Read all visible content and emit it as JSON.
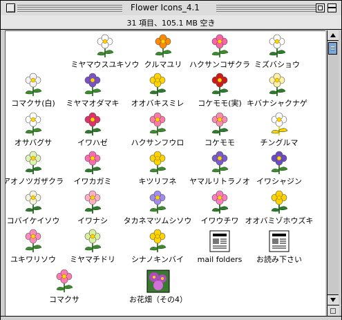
{
  "window": {
    "title": "Flower Icons_4.1",
    "info": "31 項目、105.1 MB 空き"
  },
  "items": [
    {
      "label": "ミヤマウスユキソウ",
      "icon": "white-edelweiss-flower-icon",
      "colors": [
        "#ffffff",
        "#3f8a2f"
      ]
    },
    {
      "label": "クルマユリ",
      "icon": "orange-lily-flower-icon",
      "colors": [
        "#ff8a00",
        "#3f8a2f"
      ]
    },
    {
      "label": "ハクサンコザクラ",
      "icon": "pink-primrose-flower-icon",
      "colors": [
        "#ff5ea8",
        "#3f8a2f"
      ]
    },
    {
      "label": "ミズバショウ",
      "icon": "white-skunk-cabbage-icon",
      "colors": [
        "#ffffff",
        "#2f7a2f"
      ]
    },
    {
      "label": "コマクサ(白)",
      "icon": "white-dicentra-flower-icon",
      "colors": [
        "#f4f4f4",
        "#3f8a2f"
      ]
    },
    {
      "label": "ミヤマオダマキ",
      "icon": "purple-columbine-flower-icon",
      "colors": [
        "#7a4fc8",
        "#3f8a2f"
      ]
    },
    {
      "label": "オオバキスミレ",
      "icon": "yellow-violet-flower-icon",
      "colors": [
        "#ffd400",
        "#2f7a2f"
      ]
    },
    {
      "label": "コケモモ(実)",
      "icon": "red-berries-icon",
      "colors": [
        "#d01818",
        "#2f7a2f"
      ]
    },
    {
      "label": "キバナシャクナゲ",
      "icon": "cream-rhododendron-flower-icon",
      "colors": [
        "#fff2a8",
        "#2f7a2f"
      ]
    },
    {
      "label": "オサバグサ",
      "icon": "white-fern-flower-icon",
      "colors": [
        "#ffffff",
        "#3f8a2f"
      ]
    },
    {
      "label": "イワハゼ",
      "icon": "red-white-bell-flower-icon",
      "colors": [
        "#e0306a",
        "#2f7a2f"
      ]
    },
    {
      "label": "ハクサンフウロ",
      "icon": "pink-geranium-flower-icon",
      "colors": [
        "#ff7aa8",
        "#3f8a2f"
      ]
    },
    {
      "label": "コケモモ",
      "icon": "pink-bell-flower-icon",
      "colors": [
        "#ff8ab0",
        "#2f7a2f"
      ]
    },
    {
      "label": "チングルマ",
      "icon": "white-avens-flower-icon",
      "colors": [
        "#ffffff",
        "#ffd400"
      ]
    },
    {
      "label": "アオノツガザクラ",
      "icon": "pale-green-bell-flower-icon",
      "colors": [
        "#dff2b8",
        "#2f7a2f"
      ]
    },
    {
      "label": "イワカガミ",
      "icon": "pink-fringed-flower-icon",
      "colors": [
        "#ff6ab4",
        "#2f7a2f"
      ]
    },
    {
      "label": "キツリフネ",
      "icon": "yellow-touch-me-not-flower-icon",
      "colors": [
        "#ffd400",
        "#3f8a2f"
      ]
    },
    {
      "label": "ヤマルリトラノオ",
      "icon": "purple-speedwell-spike-icon",
      "colors": [
        "#7a5acc",
        "#3f8a2f"
      ]
    },
    {
      "label": "イワシャジン",
      "icon": "purple-bellflower-icon",
      "colors": [
        "#6a4ac8",
        "#3f8a2f"
      ]
    },
    {
      "label": "コバイケイソウ",
      "icon": "white-false-hellebore-icon",
      "colors": [
        "#f4f4e0",
        "#2f7a2f"
      ]
    },
    {
      "label": "イワナシ",
      "icon": "pink-epigaea-flower-icon",
      "colors": [
        "#ffb0c8",
        "#2f7a2f"
      ]
    },
    {
      "label": "タカネマツムシソウ",
      "icon": "lavender-scabious-flower-icon",
      "colors": [
        "#a08cf0",
        "#3f8a2f"
      ]
    },
    {
      "label": "イワウチワ",
      "icon": "pink-shortia-flower-icon",
      "colors": [
        "#ff7ac0",
        "#2f7a2f"
      ]
    },
    {
      "label": "オオバミゾホウズキ",
      "icon": "yellow-monkeyflower-icon",
      "colors": [
        "#ffd400",
        "#2f7a2f"
      ]
    },
    {
      "label": "ユキワリソウ",
      "icon": "pink-hepatica-flower-icon",
      "colors": [
        "#ff8ac0",
        "#3f8a2f"
      ]
    },
    {
      "label": "ミヤマチドリ",
      "icon": "green-orchid-flower-icon",
      "colors": [
        "#d8f0a0",
        "#3f8a2f"
      ]
    },
    {
      "label": "シナノキンバイ",
      "icon": "yellow-globeflower-icon",
      "colors": [
        "#ffd400",
        "#3f8a2f"
      ]
    },
    {
      "label": "mail folders",
      "icon": "mail-folders-document-icon",
      "colors": [
        "#f0f0f0",
        "#888888"
      ]
    },
    {
      "label": "お読み下さい",
      "icon": "read-me-newspaper-document-icon",
      "colors": [
        "#ffffff",
        "#000000"
      ]
    },
    {
      "label": "コマクサ",
      "icon": "pink-dicentra-flower-icon",
      "colors": [
        "#ff7ab0",
        "#3f8a2f"
      ]
    },
    {
      "label": "お花畑（その4）",
      "icon": "flower-field-photo-icon",
      "colors": [
        "#b04ac0",
        "#3f8a2f"
      ]
    }
  ]
}
